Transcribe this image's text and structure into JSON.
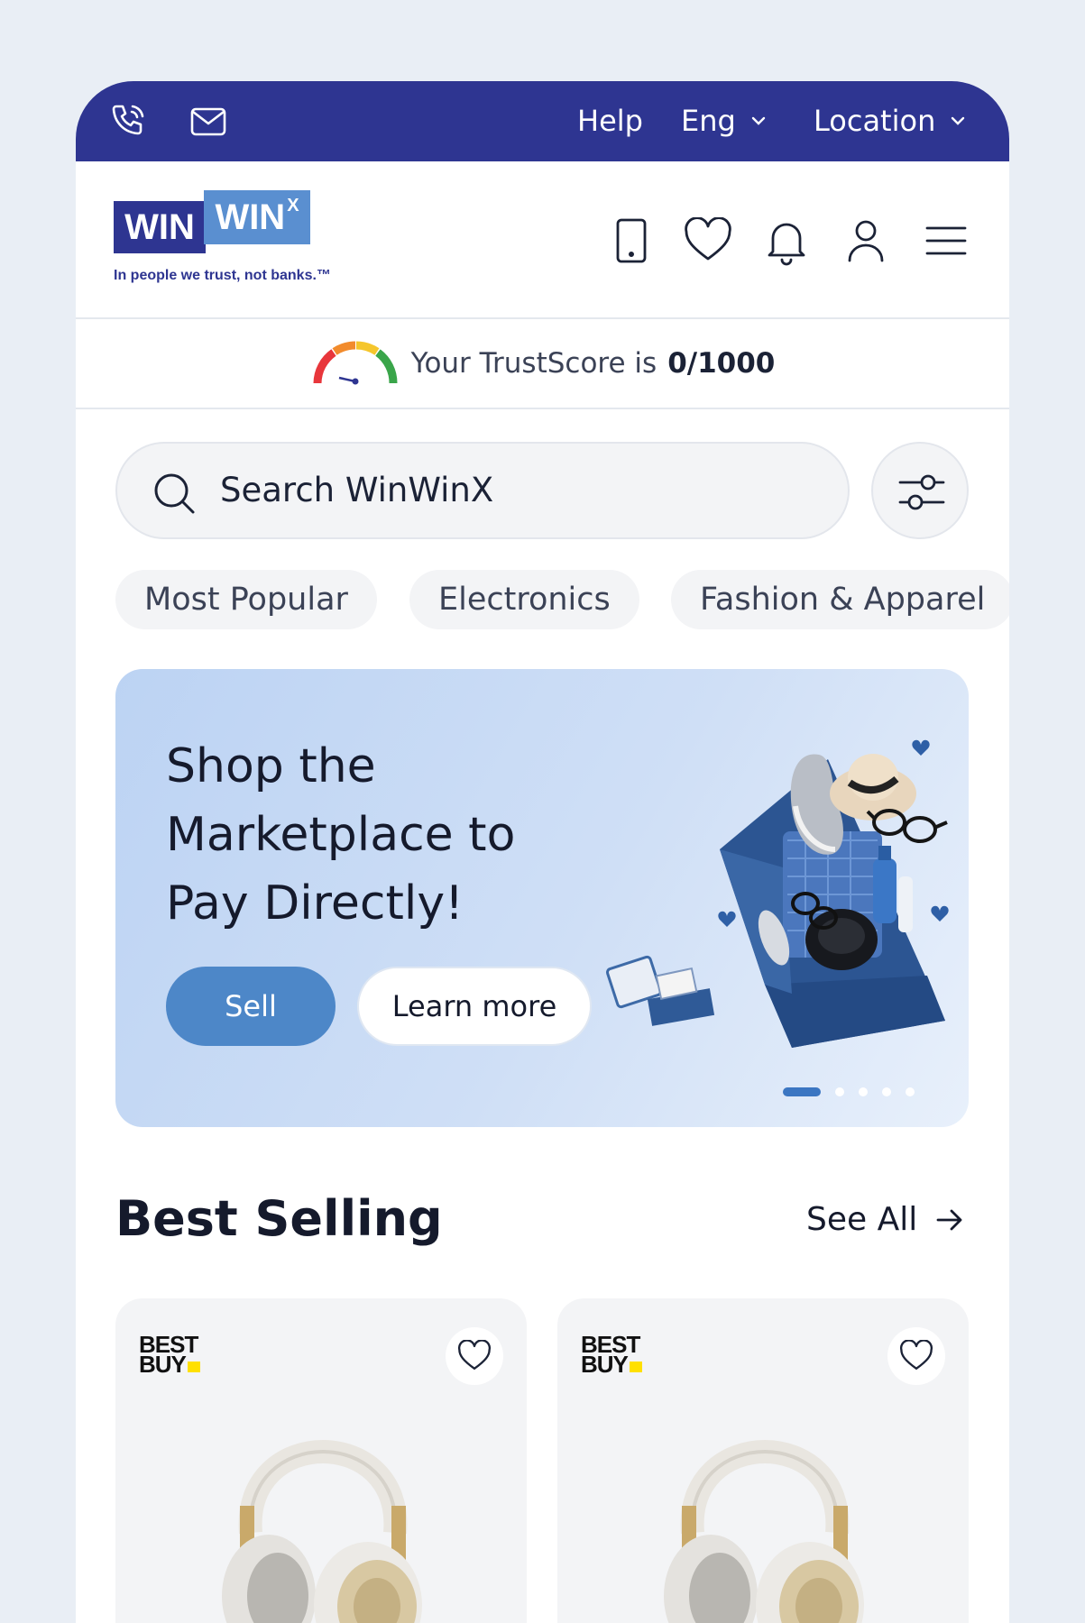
{
  "topbar": {
    "help_label": "Help",
    "lang_label": "Eng",
    "location_label": "Location",
    "bg_color": "#2e3591"
  },
  "brand": {
    "logo_word1": "WIN",
    "logo_word2": "WIN",
    "logo_super": "X",
    "tagline": "In people we trust, not banks.™"
  },
  "header_icons": [
    "phone-device-icon",
    "heart-icon",
    "bell-icon",
    "user-icon",
    "menu-icon"
  ],
  "trustscore": {
    "prefix": "Your TrustScore is",
    "value": "0/1000"
  },
  "search": {
    "placeholder": "Search WinWinX"
  },
  "chips": [
    "Most Popular",
    "Electronics",
    "Fashion & Apparel"
  ],
  "banner": {
    "line1": "Shop the",
    "line2": "Marketplace to",
    "line3": "Pay Directly!",
    "primary_button": "Sell",
    "secondary_button": "Learn more",
    "slide_count": 5,
    "active_slide": 1,
    "accent_color": "#4d87c8"
  },
  "best_selling": {
    "title": "Best Selling",
    "see_all": "See All",
    "cards": [
      {
        "brand_line1": "BEST",
        "brand_line2": "BUY",
        "product": "headphones"
      },
      {
        "brand_line1": "BEST",
        "brand_line2": "BUY",
        "product": "headphones"
      }
    ]
  }
}
